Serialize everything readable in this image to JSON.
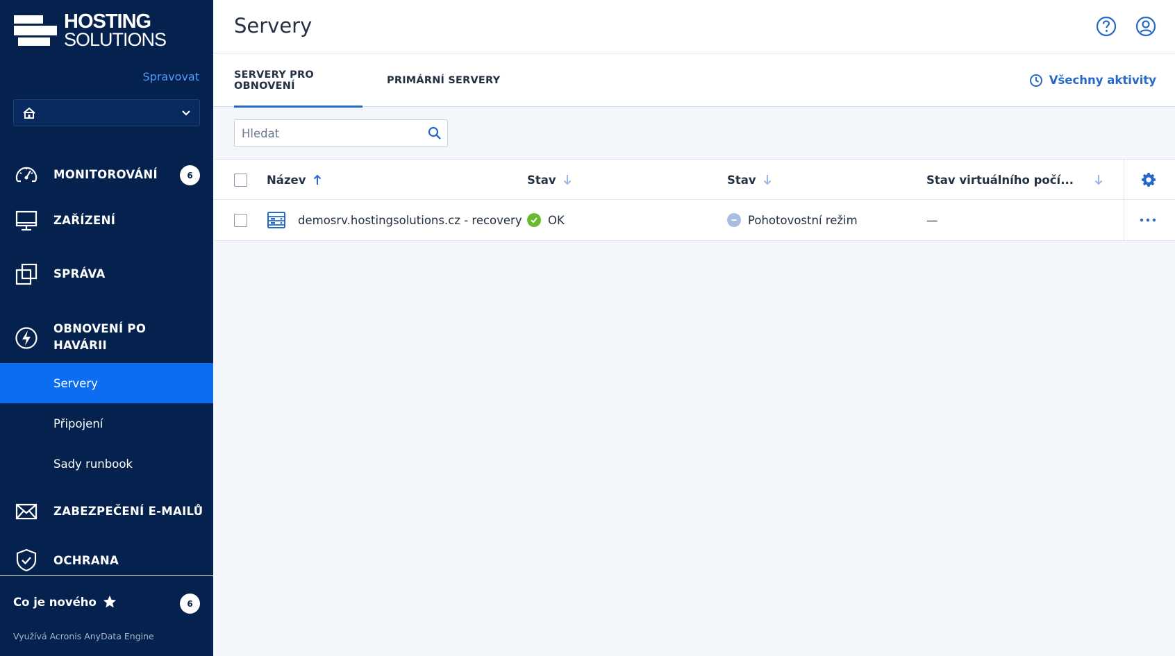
{
  "sidebar": {
    "logo_line1": "HOSTING",
    "logo_line2": "SOLUTIONS",
    "manage_link": "Spravovat",
    "nav": {
      "monitoring": {
        "label": "MONITOROVÁNÍ",
        "badge": "6"
      },
      "devices": {
        "label": "ZAŘÍZENÍ"
      },
      "management": {
        "label": "SPRÁVA"
      },
      "disaster_recovery": {
        "label_line1": "OBNOVENÍ PO",
        "label_line2": "HAVÁRII"
      },
      "email_security": {
        "label": "ZABEZPEČENÍ E-MAILŮ"
      },
      "protection": {
        "label": "OCHRANA"
      }
    },
    "sub_items": [
      "Servery",
      "Připojení",
      "Sady runbook"
    ],
    "whats_new": {
      "label": "Co je nového",
      "badge": "6"
    },
    "footer": "Využívá Acronis AnyData Engine"
  },
  "header": {
    "title": "Servery"
  },
  "tabs": [
    {
      "label": "SERVERY PRO OBNOVENÍ",
      "active": true
    },
    {
      "label": "PRIMÁRNÍ SERVERY",
      "active": false
    }
  ],
  "activities_link": "Všechny aktivity",
  "search": {
    "placeholder": "Hledat",
    "value": ""
  },
  "table": {
    "columns": [
      "Název",
      "Stav",
      "Stav",
      "Stav virtuálního počí..."
    ],
    "rows": [
      {
        "name": "demosrv.hostingsolutions.cz - recovery",
        "status": "OK",
        "state": "Pohotovostní režim",
        "vm_state": "—"
      }
    ]
  },
  "colors": {
    "sidebar_bg": "#05214e",
    "accent": "#0c6cf2",
    "link": "#2668c5",
    "ok": "#6aba2f",
    "standby": "#a9bde0"
  },
  "icons": [
    "speedometer-icon",
    "monitor-icon",
    "copy-squares-icon",
    "lightning-icon",
    "envelope-icon",
    "shield-check-icon",
    "star-icon",
    "help-icon",
    "account-icon",
    "clock-icon",
    "search-icon",
    "gear-icon",
    "more-icon",
    "server-icon",
    "chevron-down-icon",
    "home-icon"
  ]
}
